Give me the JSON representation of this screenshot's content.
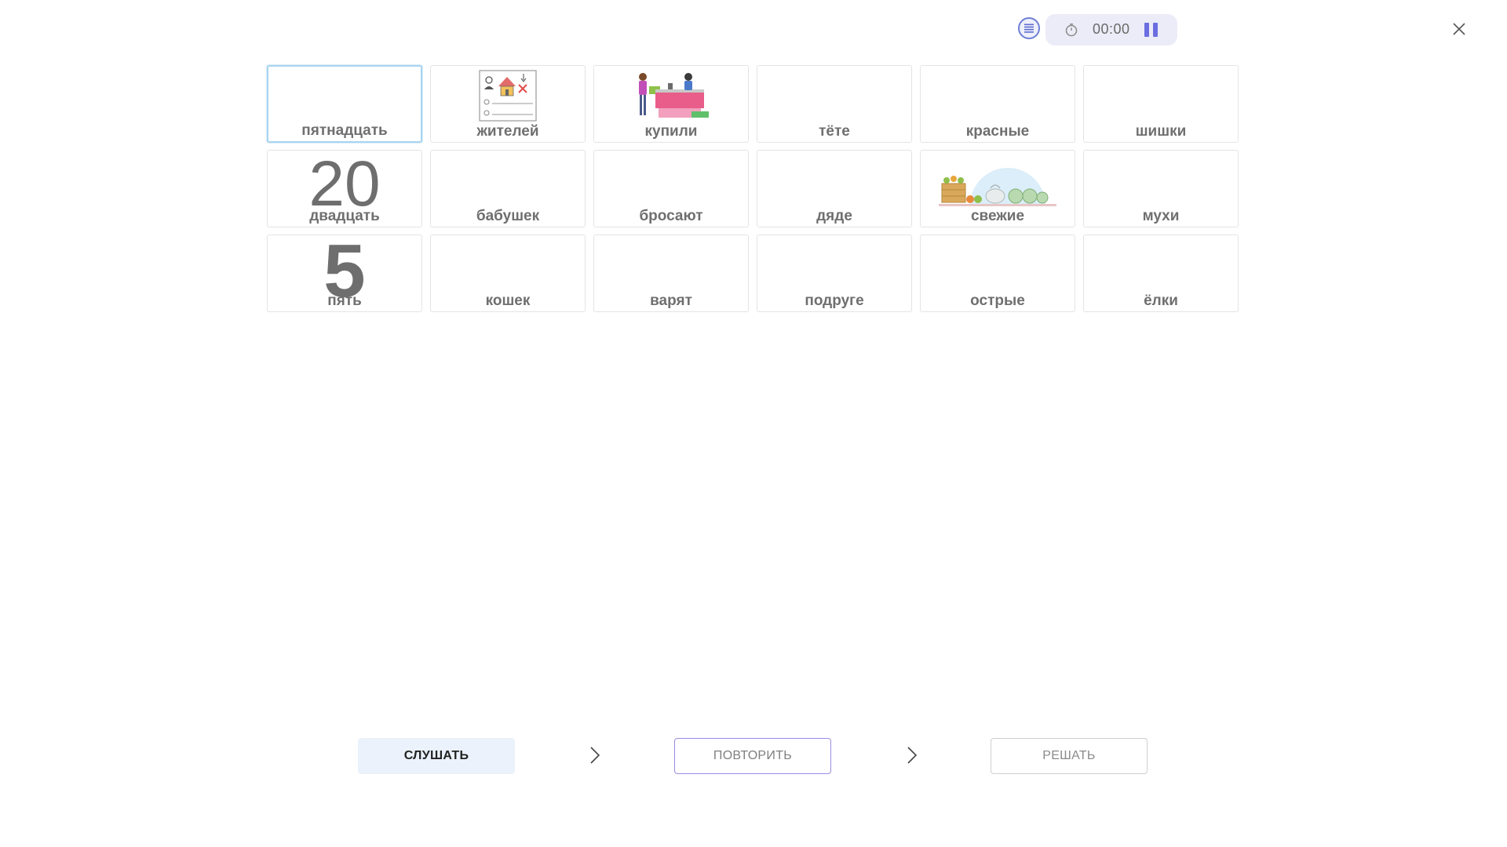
{
  "header": {
    "menu_icon": "list-icon",
    "timer_icon": "stopwatch-icon",
    "timer_value": "00:00",
    "pause_icon": "pause-icon",
    "close_icon": "close-icon"
  },
  "cards": [
    {
      "label": "пятнадцать",
      "selected": true
    },
    {
      "label": "жителей",
      "image": "residents-form-illustration"
    },
    {
      "label": "купили",
      "image": "shop-counter-illustration"
    },
    {
      "label": "тёте"
    },
    {
      "label": "красные"
    },
    {
      "label": "шишки"
    },
    {
      "label": "двадцать",
      "number": "20"
    },
    {
      "label": "бабушек"
    },
    {
      "label": "бросают"
    },
    {
      "label": "дяде"
    },
    {
      "label": "свежие",
      "image": "fresh-vegetables-illustration"
    },
    {
      "label": "мухи"
    },
    {
      "label": "пять",
      "number": "5"
    },
    {
      "label": "кошек"
    },
    {
      "label": "варят"
    },
    {
      "label": "подруге"
    },
    {
      "label": "острые"
    },
    {
      "label": "ёлки"
    }
  ],
  "footer": {
    "listen_label": "СЛУШАТЬ",
    "repeat_label": "ПОВТОРИТЬ",
    "solve_label": "РЕШАТЬ",
    "arrow_icon": "chevron-right-icon"
  },
  "colors": {
    "accent": "#6b6ee0",
    "selected_border": "#a9d4f0",
    "listen_bg": "#ebf2fc",
    "repeat_border": "#9c8de0"
  }
}
